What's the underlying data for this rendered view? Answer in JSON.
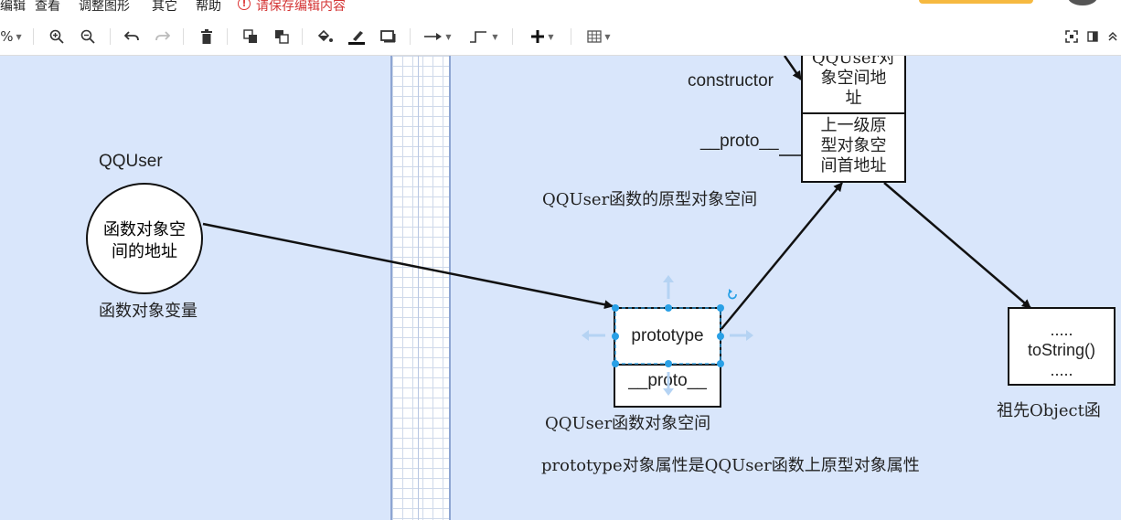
{
  "menu": {
    "items": [
      "编辑",
      "查看",
      "调整图形",
      "其它",
      "帮助"
    ],
    "notice": "请保存编辑内容"
  },
  "toolbar": {
    "zoom_suffix": "%"
  },
  "diagram": {
    "circle_title": "QQUser",
    "circle_text": [
      "函数对象空",
      "间的地址"
    ],
    "circle_caption": "函数对象变量",
    "func_box": {
      "row1": "prototype",
      "row2": "__proto__"
    },
    "func_caption": "QQUser函数对象空间",
    "bottom_note": "prototype对象属性是QQUser函数上原型对象属性",
    "proto_box": {
      "row1": [
        "QQUser对",
        "象空间地",
        "址"
      ],
      "row2": [
        "上一级原",
        "型对象空",
        "间首地址"
      ]
    },
    "constructor_label": "constructor",
    "proto_label": "__proto__",
    "proto_caption": "QQUser函数的原型对象空间",
    "object_box": {
      "line1": ".....",
      "line2": "toString()",
      "line3": "....."
    },
    "object_caption": "祖先Object函"
  },
  "colors": {
    "canvas": "#d9e6fb",
    "selection": "#29a0e6",
    "warning": "#d33333"
  }
}
